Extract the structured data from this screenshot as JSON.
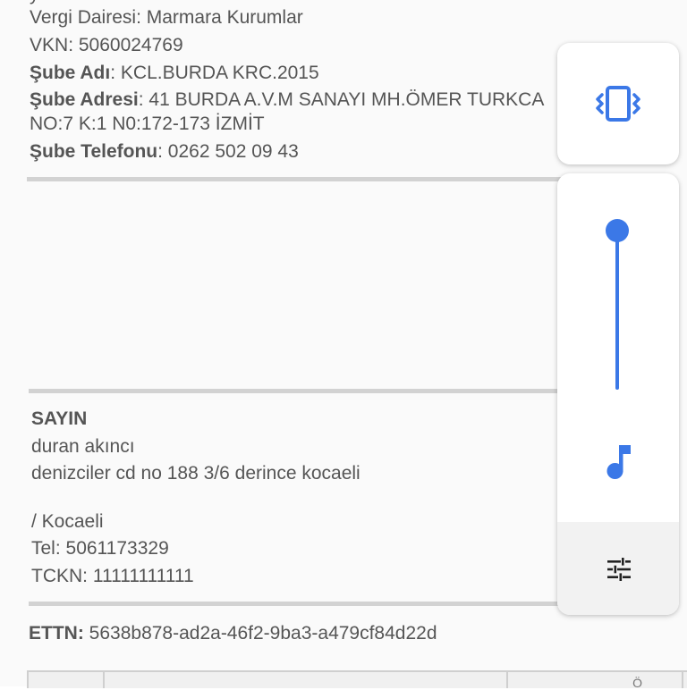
{
  "invoice": {
    "partial_top_line": "y",
    "tax_office_label": "Vergi Dairesi",
    "tax_office_value": ": Marmara Kurumlar",
    "vkn_label": "VKN",
    "vkn_value": ": 5060024769",
    "branch_name_label": "Şube Adı",
    "branch_name_value": ": KCL.BURDA KRC.2015",
    "branch_address_label": "Şube Adresi",
    "branch_address_value": ": 41 BURDA A.V.M SANAYI MH.ÖMER TURKCA",
    "branch_address_line2": "NO:7 K:1 N0:172-173 İZMİT",
    "branch_phone_label": "Şube Telefonu",
    "branch_phone_value": ": 0262 502 09 43"
  },
  "recipient": {
    "heading": "SAYIN",
    "name": "duran akıncı",
    "address": "denizciler cd no 188 3/6 derince kocaeli",
    "city": "/ Kocaeli",
    "phone": "Tel: 5061173329",
    "tckn": "TCKN: 11111111111"
  },
  "ettn": {
    "label": "ETTN:",
    "value": "5638b878-ad2a-46f2-9ba3-a479cf84d22d"
  },
  "table_fragment": {
    "partial_header": "Ö"
  },
  "volume_panel": {
    "ringer_mode_icon": "vibrate-icon",
    "stream_icon": "music-note-icon",
    "settings_icon": "tune-icon",
    "volume_level": 1.0,
    "accent_color": "#3b78e7"
  }
}
